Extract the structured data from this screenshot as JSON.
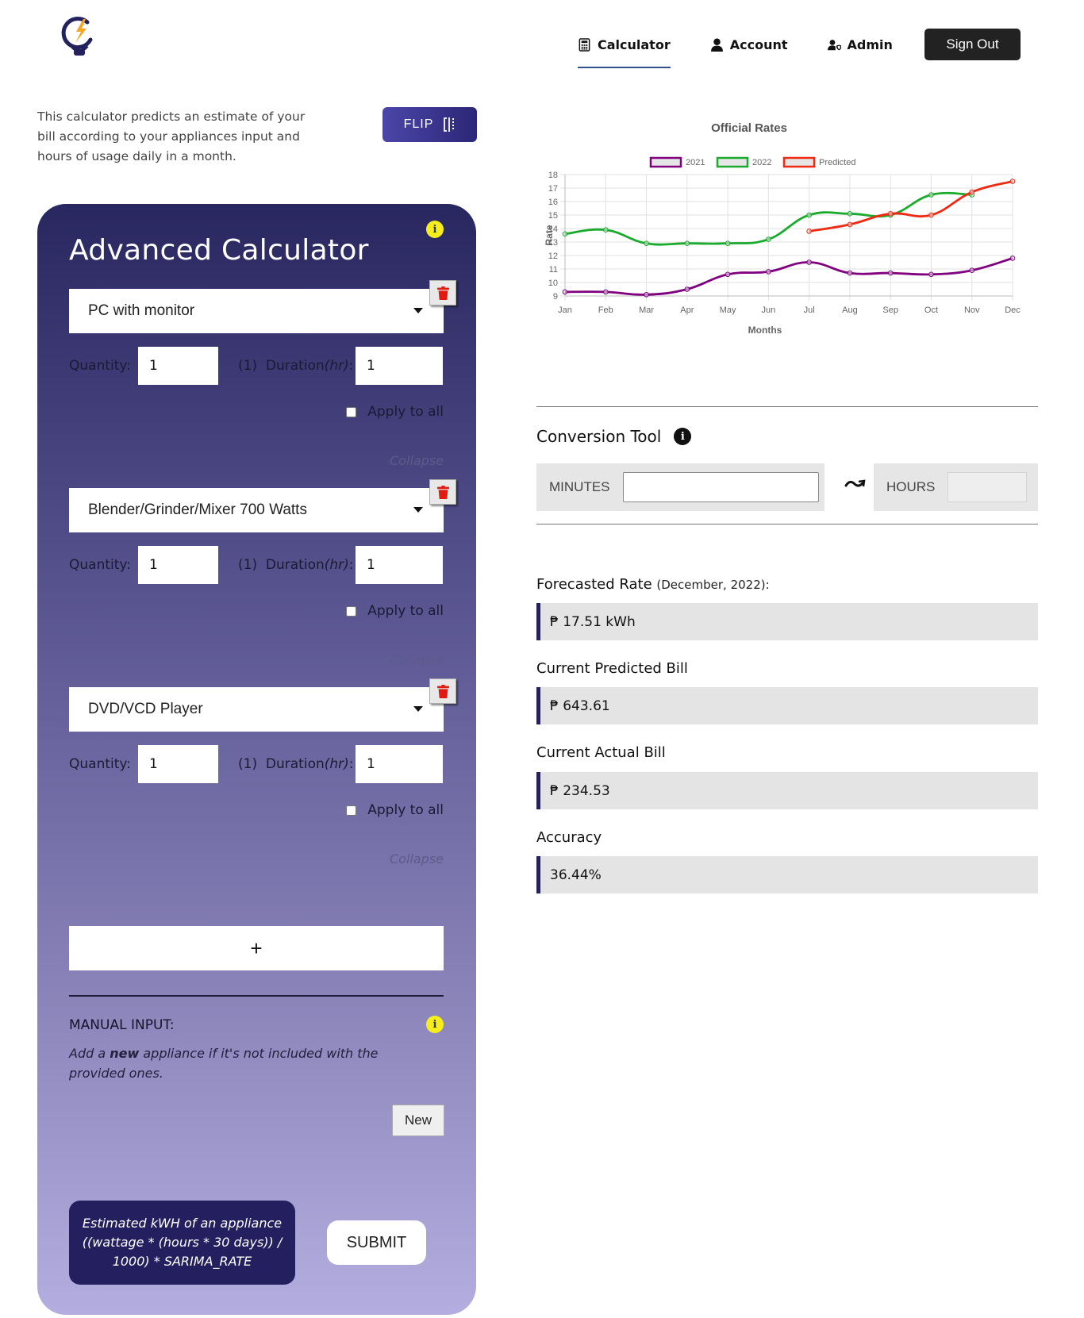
{
  "header": {
    "logo": "lightbulb-bolt-logo",
    "nav": [
      {
        "label": "Calculator",
        "icon": "calculator-icon",
        "active": true
      },
      {
        "label": "Account",
        "icon": "user-icon",
        "active": false
      },
      {
        "label": "Admin",
        "icon": "user-shield-icon",
        "active": false
      }
    ],
    "sign_out_label": "Sign Out"
  },
  "intro": {
    "text": "This calculator predicts an estimate of your bill according to your appliances input and hours of usage daily in a month.",
    "flip_label": "FLIP",
    "flip_icon": "flip-columns-icon"
  },
  "calculator": {
    "title": "Advanced Calculator",
    "appliances": [
      {
        "name": "PC with monitor",
        "quantity_label": "Quantity:",
        "quantity": "1",
        "duration_prefix": "(1)",
        "duration_label": "Duration",
        "duration_unit": "(hr)",
        "duration_suffix": ":",
        "duration": "1",
        "apply_all_label": "Apply to all",
        "apply_all_checked": false,
        "collapse_label": "Collapse"
      },
      {
        "name": "Blender/Grinder/Mixer 700 Watts",
        "quantity_label": "Quantity:",
        "quantity": "1",
        "duration_prefix": "(1)",
        "duration_label": "Duration",
        "duration_unit": "(hr)",
        "duration_suffix": ":",
        "duration": "1",
        "apply_all_label": "Apply to all",
        "apply_all_checked": false,
        "collapse_label": "Collapse"
      },
      {
        "name": "DVD/VCD Player",
        "quantity_label": "Quantity:",
        "quantity": "1",
        "duration_prefix": "(1)",
        "duration_label": "Duration",
        "duration_unit": "(hr)",
        "duration_suffix": ":",
        "duration": "1",
        "apply_all_label": "Apply to all",
        "apply_all_checked": false,
        "collapse_label": "Collapse"
      }
    ],
    "add_label": "+",
    "manual_input": {
      "title": "MANUAL INPUT:",
      "desc_pre": "Add a ",
      "desc_bold": "new",
      "desc_post": " appliance if it's not included with the provided ones.",
      "new_label": "New"
    },
    "formula": "Estimated kWH of an appliance ((wattage * (hours * 30 days)) / 1000) * SARIMA_RATE",
    "submit_label": "SUBMIT"
  },
  "chart_data": {
    "type": "line",
    "title": "Official Rates",
    "xlabel": "Months",
    "ylabel": "Rate",
    "categories": [
      "Jan",
      "Feb",
      "Mar",
      "Apr",
      "May",
      "Jun",
      "Jul",
      "Aug",
      "Sep",
      "Oct",
      "Nov",
      "Dec"
    ],
    "ylim": [
      9,
      18
    ],
    "yticks": [
      9,
      10,
      11,
      12,
      13,
      14,
      15,
      16,
      17,
      18
    ],
    "grid": true,
    "legend": "top",
    "series": [
      {
        "name": "2021",
        "color": "#800080",
        "values": [
          9.3,
          9.3,
          9.1,
          9.5,
          10.6,
          10.8,
          11.5,
          10.7,
          10.7,
          10.6,
          10.9,
          11.8
        ]
      },
      {
        "name": "2022",
        "color": "#1aab2c",
        "values": [
          13.6,
          13.9,
          12.9,
          12.9,
          12.9,
          13.2,
          15.0,
          15.1,
          15.0,
          16.5,
          16.5,
          null
        ]
      },
      {
        "name": "Predicted",
        "color": "#f02a12",
        "values": [
          null,
          null,
          null,
          null,
          null,
          null,
          13.8,
          14.3,
          15.1,
          15.0,
          16.7,
          17.5
        ]
      }
    ]
  },
  "conversion": {
    "title": "Conversion Tool",
    "minutes_label": "MINUTES",
    "minutes_value": "",
    "hours_label": "HOURS",
    "hours_value": ""
  },
  "results": {
    "forecast_label": "Forecasted Rate",
    "forecast_period": "(December, 2022):",
    "forecast_value": "₱ 17.51 kWh",
    "predicted_label": "Current Predicted Bill",
    "predicted_value": "₱ 643.61",
    "actual_label": "Current Actual Bill",
    "actual_value": "₱ 234.53",
    "accuracy_label": "Accuracy",
    "accuracy_value": "36.44%"
  }
}
